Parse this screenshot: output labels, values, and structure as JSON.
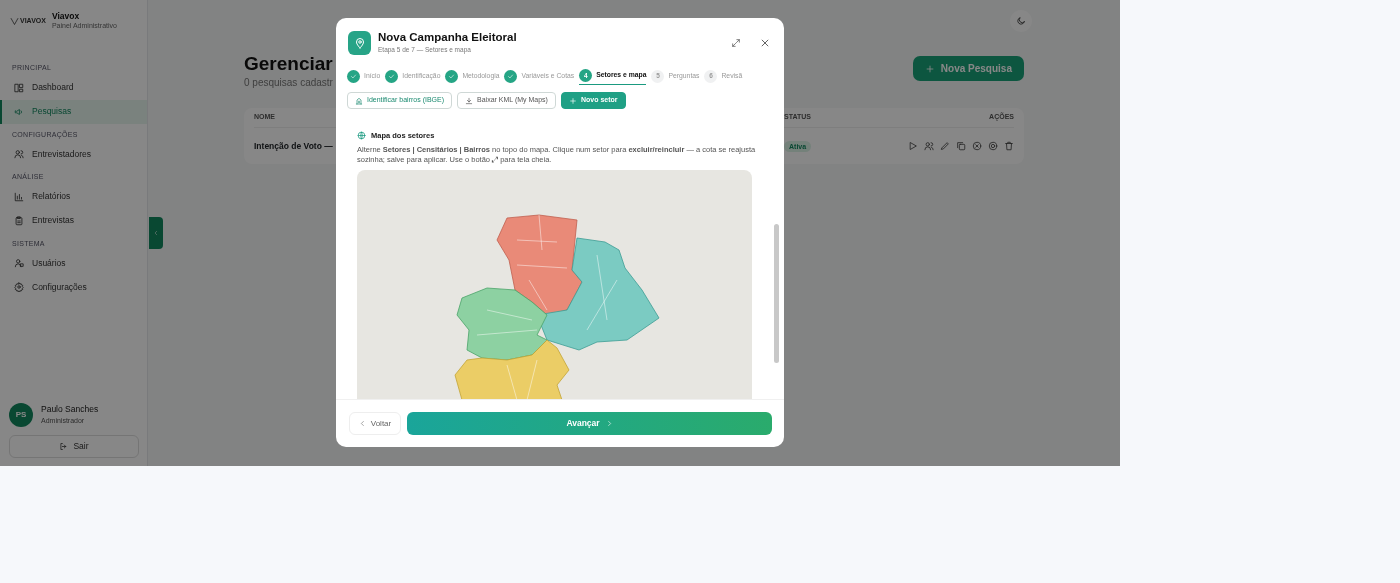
{
  "sidebar": {
    "brand": {
      "logo_text": "VIAVOX",
      "name": "Viavox",
      "subtitle": "Painel Administrativo"
    },
    "sections": [
      {
        "title": "PRINCIPAL",
        "items": [
          {
            "label": "Dashboard",
            "selected": false
          },
          {
            "label": "Pesquisas",
            "selected": true
          }
        ]
      },
      {
        "title": "CONFIGURAÇÕES",
        "items": [
          {
            "label": "Entrevistadores",
            "selected": false
          }
        ]
      },
      {
        "title": "ANÁLISE",
        "items": [
          {
            "label": "Relatórios",
            "selected": false
          },
          {
            "label": "Entrevistas",
            "selected": false
          }
        ]
      },
      {
        "title": "SISTEMA",
        "items": [
          {
            "label": "Usuários",
            "selected": false
          },
          {
            "label": "Configurações",
            "selected": false
          }
        ]
      }
    ],
    "user": {
      "initials": "PS",
      "name": "Paulo Sanches",
      "role": "Administrador"
    },
    "logout": "Sair"
  },
  "main": {
    "title": "Gerenciar",
    "subtitle": "0 pesquisas cadastr",
    "new_button": "Nova Pesquisa",
    "table": {
      "columns": [
        "NOME",
        "STATUS",
        "AÇÕES"
      ],
      "rows": [
        {
          "name": "Intenção de Voto —",
          "status": "Ativa"
        }
      ]
    }
  },
  "modal": {
    "title": "Nova Campanha Eleitoral",
    "subtitle": "Etapa 5 de 7 — Setores e mapa",
    "steps": [
      {
        "label": "Início",
        "kind": "done",
        "selected": false
      },
      {
        "label": "Identificação",
        "kind": "done",
        "selected": false
      },
      {
        "label": "Metodologia",
        "kind": "done",
        "selected": false
      },
      {
        "label": "Variáveis e Cotas",
        "kind": "done",
        "selected": false
      },
      {
        "number": "4",
        "label": "Setores e mapa",
        "kind": "current",
        "selected": true
      },
      {
        "number": "5",
        "label": "Perguntas",
        "kind": "pending",
        "selected": false
      },
      {
        "number": "6",
        "label": "Revisã",
        "kind": "pending",
        "selected": false
      }
    ],
    "actions": [
      {
        "label": "Identificar bairros (IBGE)",
        "kind": "outline"
      },
      {
        "label": "Baixar KML (My Maps)",
        "kind": "outline"
      },
      {
        "label": "Novo setor",
        "kind": "primary"
      }
    ],
    "map_panel": {
      "title": "Mapa dos setores",
      "description": "Alterne **Setores | Censitários | Bairros** no topo do mapa. Clique num setor para **excluir/reincluir** — a cota se reajusta sozinha; salve para aplicar. Use o botão ⤢ para tela cheia."
    },
    "footer": {
      "back": "Voltar",
      "next": "Avançar"
    }
  }
}
